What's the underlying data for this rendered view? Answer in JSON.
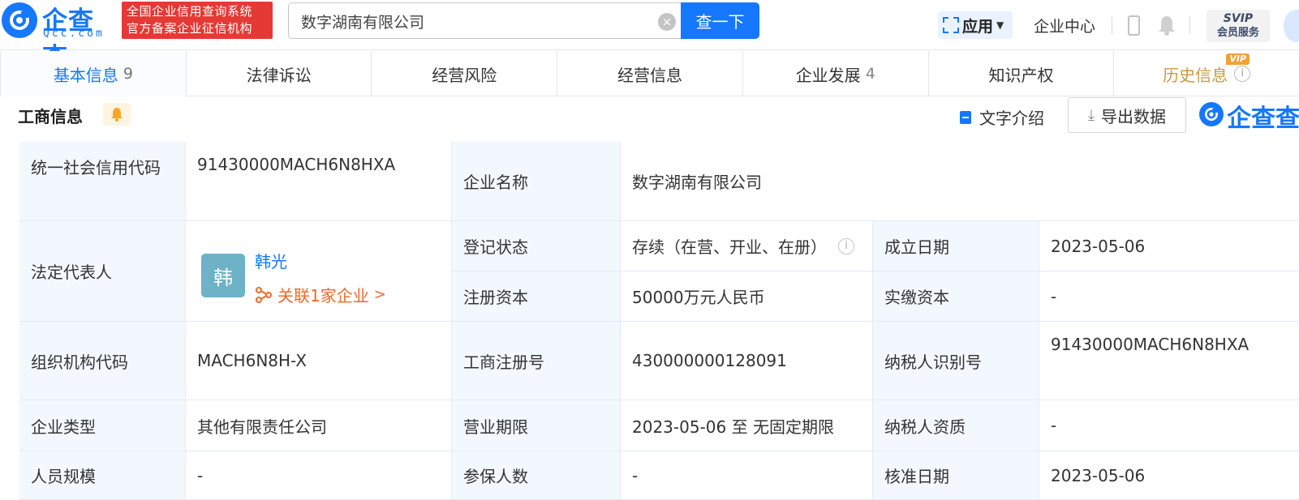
{
  "brand": {
    "name": "企查查",
    "domain": "Qcc.com",
    "badge_line1": "全国企业信用查询系统",
    "badge_line2": "官方备案企业征信机构"
  },
  "search": {
    "value": "数字湖南有限公司",
    "button_label": "查一下"
  },
  "nav": {
    "apps_label": "应用",
    "enterprise_center": "企业中心",
    "svip_line1": "SVIP",
    "svip_line2": "会员服务"
  },
  "tabs": [
    {
      "label": "基本信息",
      "count": "9"
    },
    {
      "label": "法律诉讼",
      "count": ""
    },
    {
      "label": "经营风险",
      "count": ""
    },
    {
      "label": "经营信息",
      "count": ""
    },
    {
      "label": "企业发展",
      "count": "4"
    },
    {
      "label": "知识产权",
      "count": ""
    },
    {
      "label": "历史信息",
      "count": "",
      "tag": "VIP"
    }
  ],
  "section": {
    "title": "工商信息",
    "text_intro": "文字介绍",
    "export": "导出数据",
    "watermark_logo": "企查查"
  },
  "business_info": {
    "credit_code_label": "统一社会信用代码",
    "credit_code": "91430000MACH6N8HXA",
    "company_name_label": "企业名称",
    "company_name": "数字湖南有限公司",
    "legal_rep_label": "法定代表人",
    "legal_rep_avatar": "韩",
    "legal_rep_name": "韩光",
    "legal_rep_related": "关联1家企业",
    "reg_status_label": "登记状态",
    "reg_status": "存续（在营、开业、在册）",
    "founded_label": "成立日期",
    "founded": "2023-05-06",
    "reg_capital_label": "注册资本",
    "reg_capital": "50000万元人民币",
    "paid_capital_label": "实缴资本",
    "paid_capital": "-",
    "org_code_label": "组织机构代码",
    "org_code": "MACH6N8H-X",
    "reg_no_label": "工商注册号",
    "reg_no": "430000000128091",
    "taxpayer_id_label": "纳税人识别号",
    "taxpayer_id": "91430000MACH6N8HXA",
    "type_label": "企业类型",
    "type": "其他有限责任公司",
    "term_label": "营业期限",
    "term": "2023-05-06 至 无固定期限",
    "taxpayer_qual_label": "纳税人资质",
    "taxpayer_qual": "-",
    "staff_size_label": "人员规模",
    "staff_size": "-",
    "insured_label": "参保人数",
    "insured": "-",
    "approved_label": "核准日期",
    "approved": "2023-05-06"
  },
  "colors": {
    "brand_blue": "#1677ff",
    "badge_red": "#e53935",
    "label_bg": "#f3f8ff",
    "related_orange": "#f06a2a",
    "history_gold": "#c79a44"
  }
}
